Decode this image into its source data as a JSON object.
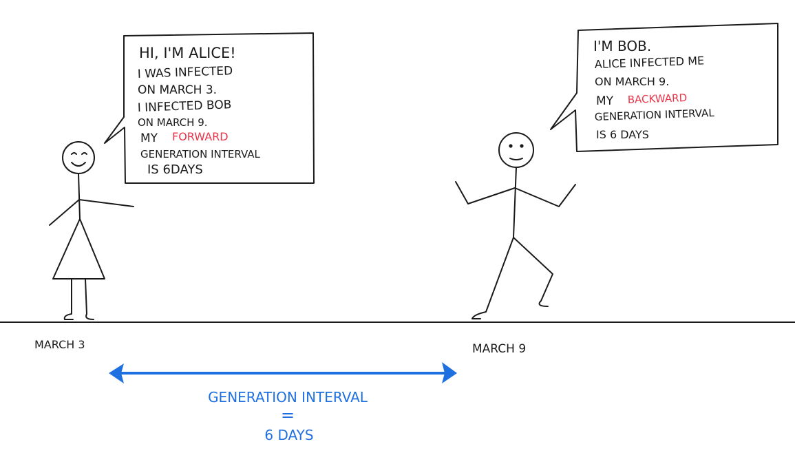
{
  "alice_bubble": {
    "line1": "HI, I'M ALICE!",
    "line2": "I WAS INFECTED",
    "line3": "ON MARCH 3.",
    "line4": "I INFECTED BOB",
    "line5": "ON MARCH 9.",
    "line6_prefix": "MY",
    "line6_highlight": "FORWARD",
    "line7": "GENERATION INTERVAL",
    "line8": "IS 6DAYS"
  },
  "bob_bubble": {
    "line1": "I'M BOB.",
    "line2": "ALICE INFECTED ME",
    "line3": "ON MARCH 9.",
    "line4_prefix": "MY",
    "line4_highlight": "BACKWARD",
    "line5": "GENERATION INTERVAL",
    "line6": "IS 6 DAYS"
  },
  "timeline": {
    "date_left": "MARCH 3",
    "date_right": "MARCH 9"
  },
  "interval": {
    "line1": "GENERATION INTERVAL",
    "line2": "=",
    "line3": "6 DAYS"
  },
  "colors": {
    "ink": "#1a1a1a",
    "highlight_red": "#e8354a",
    "interval_blue": "#1e6fe0"
  }
}
